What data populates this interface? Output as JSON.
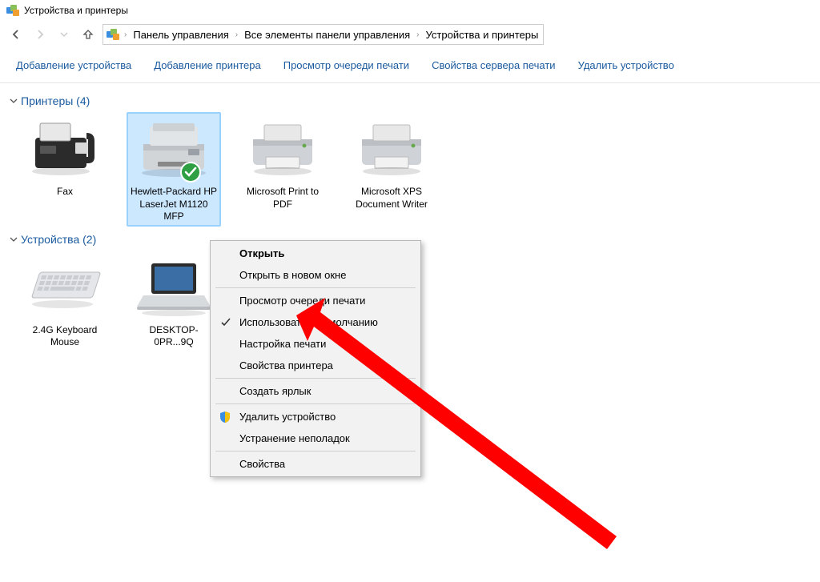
{
  "window": {
    "title": "Устройства и принтеры"
  },
  "breadcrumb": {
    "seg1": "Панель управления",
    "seg2": "Все элементы панели управления",
    "seg3": "Устройства и принтеры"
  },
  "toolbar": {
    "add_device": "Добавление устройства",
    "add_printer": "Добавление принтера",
    "view_queue": "Просмотр очереди печати",
    "server_props": "Свойства сервера печати",
    "remove_device": "Удалить устройство"
  },
  "sections": {
    "printers_label": "Принтеры (4)",
    "devices_label": "Устройства (2)"
  },
  "printers": {
    "fax": "Fax",
    "hp": "Hewlett-Packard HP LaserJet M1120 MFP",
    "mspdf": "Microsoft Print to PDF",
    "msxps": "Microsoft XPS Document Writer"
  },
  "devices": {
    "kb": "2.4G Keyboard Mouse",
    "pc": "DESKTOP-0PR...9Q"
  },
  "context_menu": {
    "open": "Открыть",
    "open_new": "Открыть в новом окне",
    "queue": "Просмотр очереди печати",
    "set_default": "Использовать по умолчанию",
    "print_settings": "Настройка печати",
    "printer_props": "Свойства принтера",
    "create_shortcut": "Создать ярлык",
    "remove": "Удалить устройство",
    "troubleshoot": "Устранение неполадок",
    "properties": "Свойства"
  }
}
